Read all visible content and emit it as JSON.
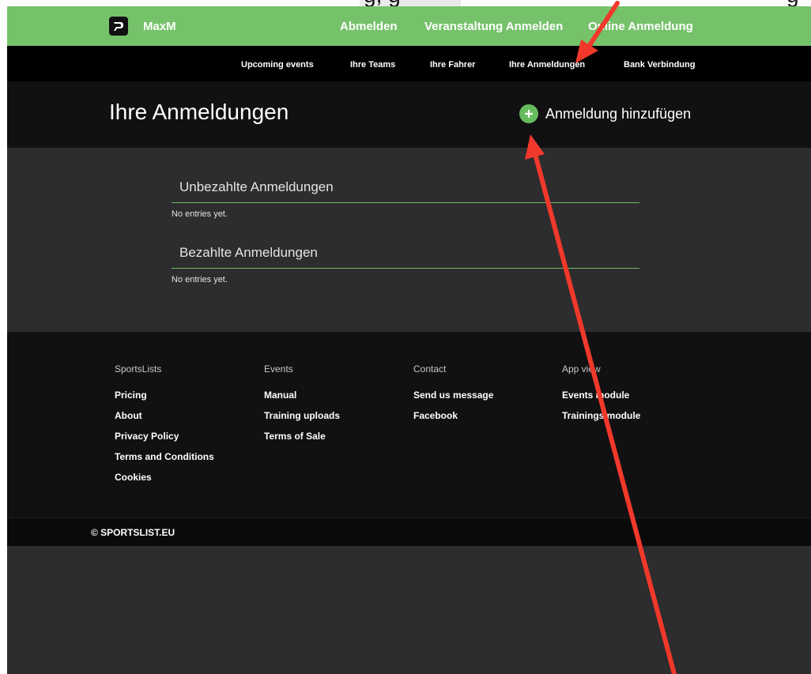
{
  "top_strip": {
    "left_text": "g, g",
    "right_text": "g"
  },
  "brand": {
    "name": "MaxM"
  },
  "top_nav": [
    "Abmelden",
    "Veranstaltung Anmelden",
    "Online Anmeldung"
  ],
  "sub_nav": [
    "Upcoming events",
    "Ihre Teams",
    "Ihre Fahrer",
    "Ihre Anmeldungen",
    "Bank Verbindung"
  ],
  "header": {
    "title": "Ihre Anmeldungen",
    "add_label": "Anmeldung hinzufügen"
  },
  "sections": [
    {
      "title": "Unbezahlte Anmeldungen",
      "empty": "No entries yet."
    },
    {
      "title": "Bezahlte Anmeldungen",
      "empty": "No entries yet."
    }
  ],
  "footer": {
    "columns": [
      {
        "heading": "SportsLists",
        "links": [
          "Pricing",
          "About",
          "Privacy Policy",
          "Terms and Conditions",
          "Cookies"
        ]
      },
      {
        "heading": "Events",
        "links": [
          "Manual",
          "Training uploads",
          "Terms of Sale"
        ]
      },
      {
        "heading": "Contact",
        "links": [
          "Send us message",
          "Facebook"
        ]
      },
      {
        "heading": "App view",
        "links": [
          "Events module",
          "Trainings module"
        ]
      }
    ],
    "copyright": "© SPORTSLIST.EU"
  },
  "colors": {
    "accent_green": "#76c26b",
    "annotation_red": "#f0392b",
    "dark_bg": "#111012",
    "panel_bg": "#2d2c2e"
  },
  "icons": {
    "logo": "brand-logo-icon",
    "add": "plus-icon"
  }
}
